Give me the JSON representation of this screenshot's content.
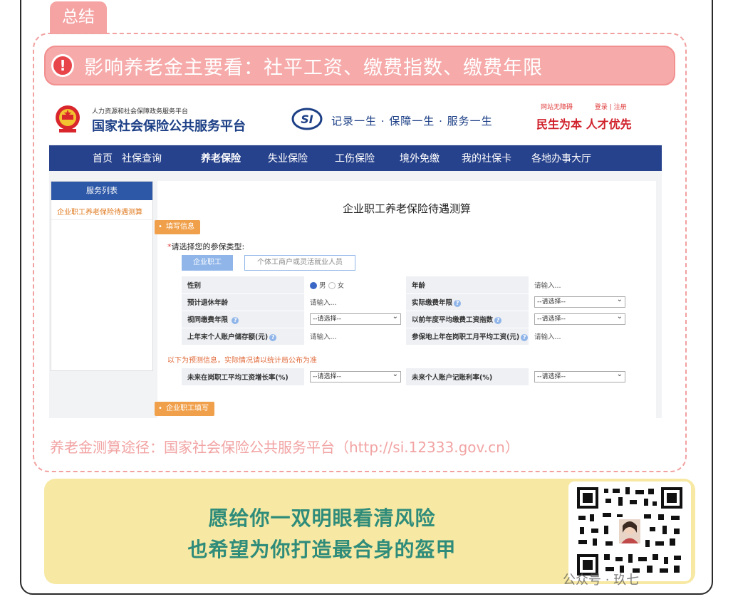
{
  "summary_tab": "总结",
  "alert": "影响养老金主要看：社平工资、缴费指数、缴费年限",
  "website": {
    "org_small": "人力资源和社会保障政务服务平台",
    "org_big": "国家社会保险公共服务平台",
    "slogan": "记录一生 · 保障一生 · 服务一生",
    "header_links": [
      "网站无障碍",
      "登录 | 注册"
    ],
    "motto": "民生为本 人才优先",
    "nav": [
      "首页",
      "社保查询",
      "养老保险",
      "失业保险",
      "工伤保险",
      "境外免缴",
      "我的社保卡",
      "各地办事大厅"
    ],
    "nav_active_index": 2,
    "sidebar_title": "服务列表",
    "sidebar_item": "企业职工养老保险待遇测算",
    "calc_title": "企业职工养老保险待遇测算",
    "flag_fill": "填写信息",
    "choose_label": "请选择您的参保类型:",
    "type_enterprise": "企业职工",
    "type_individual": "个体工商户或灵活就业人员",
    "rows": [
      {
        "l1": "性别",
        "male": "男",
        "female": "女",
        "l2": "年龄",
        "v2": "请输入..."
      },
      {
        "l1": "预计退休年龄",
        "v1": "请输入...",
        "l2": "实际缴费年限",
        "v2": "--请选择--"
      },
      {
        "l1": "视同缴费年限",
        "v1": "--请选择--",
        "l2": "以前年度平均缴费工资指数",
        "v2": "--请选择--"
      },
      {
        "l1": "上年末个人账户储存额(元)",
        "v1": "请输入...",
        "l2": "参保地上年在岗职工月平均工资(元)",
        "v2": "请输入..."
      }
    ],
    "predict_note": "以下为预测信息，实际情况请以统计局公布为准",
    "predict_row": {
      "l1": "未来在岗职工平均工资增长率(%)",
      "v1": "--请选择--",
      "l2": "未来个人账户记账利率(%)",
      "v2": "--请选择--"
    },
    "flag_enterprise": "企业职工填写"
  },
  "source_line": "养老金测算途径：国家社会保险公共服务平台（http://si.12333.gov.cn）",
  "banner_line1": "愿给你一双明眼看清风险",
  "banner_line2": "也希望为你打造最合身的盔甲",
  "watermark": "公众号 · 玖七",
  "colors": {
    "accent_pink": "#f6aaaa",
    "nav_blue": "#27428c",
    "banner_green": "#2f8c7a",
    "banner_bg": "#f7e9a3"
  }
}
